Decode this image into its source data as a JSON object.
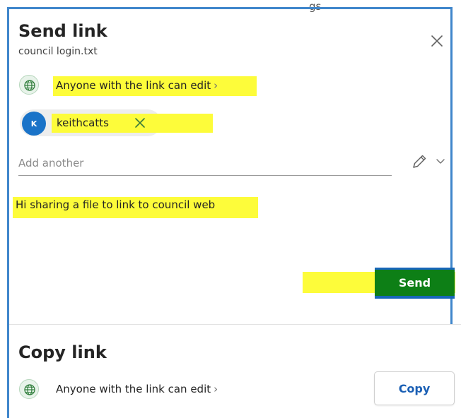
{
  "window_clip_text": "gs",
  "send_link": {
    "title": "Send link",
    "file_name": "council login.txt",
    "close_icon": "close-icon",
    "permission": {
      "icon": "globe-icon",
      "text": "Anyone with the link can edit",
      "chevron": "›"
    },
    "recipient": {
      "initial": "K",
      "name": "keithcatts",
      "remove_icon": "dismiss-icon"
    },
    "add_another_placeholder": "Add another",
    "edit_permission_icon": "pencil-icon",
    "message": "Hi sharing a file to link to council web",
    "send_label": "Send"
  },
  "copy_link": {
    "title": "Copy link",
    "permission": {
      "icon": "globe-icon",
      "text": "Anyone with the link can edit",
      "chevron": "›"
    },
    "copy_label": "Copy"
  },
  "colors": {
    "highlight": "#fdfc3a",
    "accent_blue": "#3f86cb",
    "avatar": "#1a73c8",
    "send_button": "#0d7f16",
    "copy_text": "#1a5fb4",
    "globe_bg": "#e8f3ea"
  }
}
